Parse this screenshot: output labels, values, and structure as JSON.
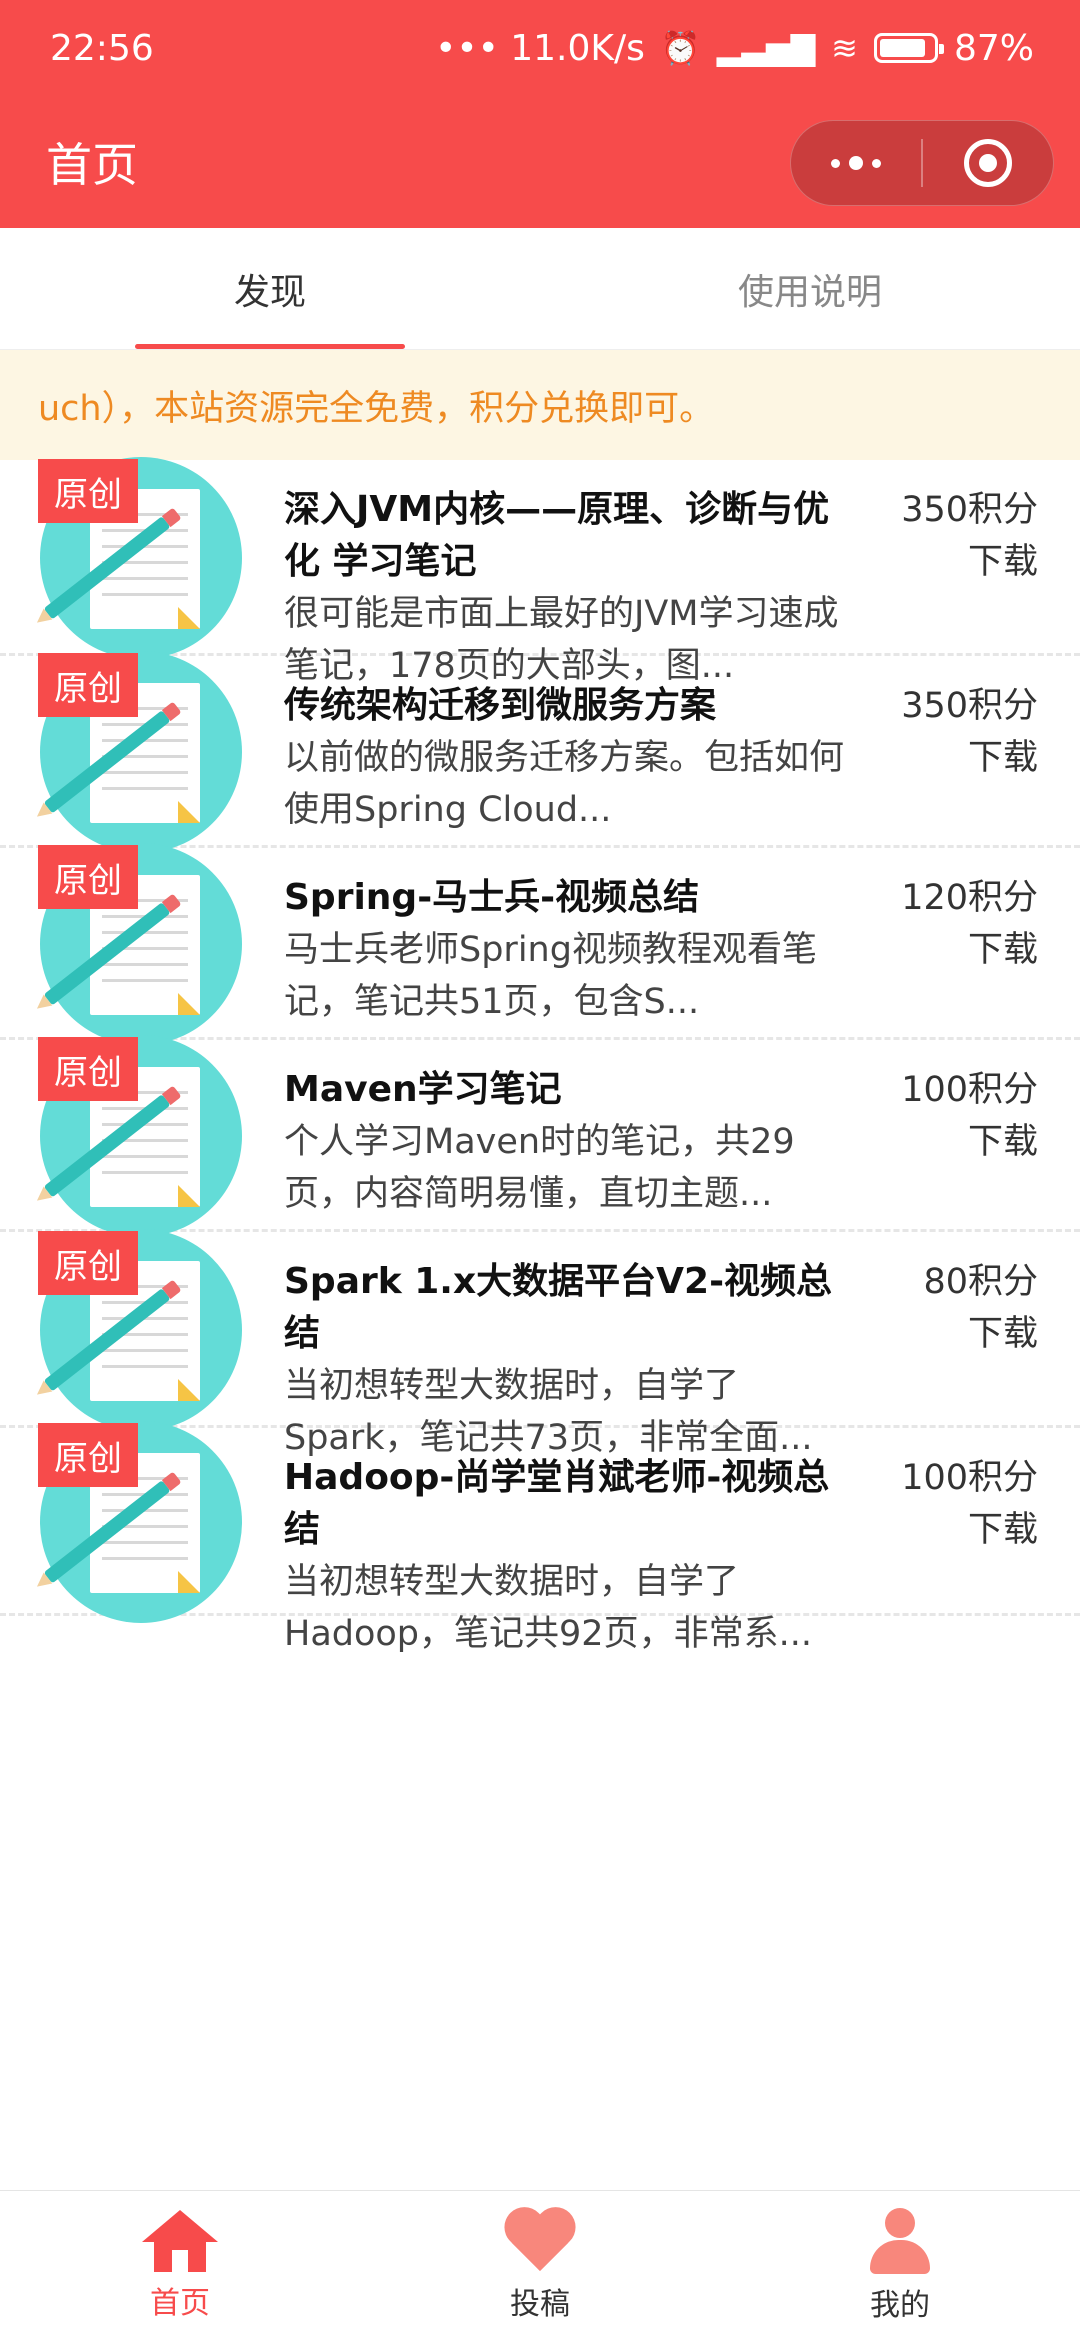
{
  "status": {
    "time": "22:56",
    "speed": "••• 11.0K/s",
    "battery": "87%",
    "battery_level": 0.87
  },
  "navbar": {
    "title": "首页"
  },
  "tabs": [
    {
      "label": "发现",
      "active": true
    },
    {
      "label": "使用说明",
      "active": false
    }
  ],
  "notice": "uch），本站资源完全免费，积分兑换即可。",
  "items": [
    {
      "badge": "原创",
      "title": "深入JVM内核——原理、诊断与优化 学习笔记",
      "desc": "很可能是市面上最好的JVM学习速成笔记，178页的大部头，图...",
      "points": "350积分",
      "action": "下载"
    },
    {
      "badge": "原创",
      "title": "传统架构迁移到微服务方案",
      "desc": "以前做的微服务迁移方案。包括如何使用Spring Cloud...",
      "points": "350积分",
      "action": "下载"
    },
    {
      "badge": "原创",
      "title": "Spring-马士兵-视频总结",
      "desc": "马士兵老师Spring视频教程观看笔记，笔记共51页，包含S...",
      "points": "120积分",
      "action": "下载"
    },
    {
      "badge": "原创",
      "title": "Maven学习笔记",
      "desc": "个人学习Maven时的笔记，共29页，内容简明易懂，直切主题...",
      "points": "100积分",
      "action": "下载"
    },
    {
      "badge": "原创",
      "title": "Spark 1.x大数据平台V2-视频总结",
      "desc": "当初想转型大数据时，自学了Spark，笔记共73页，非常全面...",
      "points": "80积分",
      "action": "下载"
    },
    {
      "badge": "原创",
      "title": "Hadoop-尚学堂肖斌老师-视频总结",
      "desc": "当初想转型大数据时，自学了Hadoop，笔记共92页，非常系...",
      "points": "100积分",
      "action": "下载"
    }
  ],
  "tabbar": [
    {
      "label": "首页",
      "icon": "home-icon",
      "active": true
    },
    {
      "label": "投稿",
      "icon": "heart-icon",
      "active": false
    },
    {
      "label": "我的",
      "icon": "user-icon",
      "active": false
    }
  ],
  "colors": {
    "brand": "#f74b4b",
    "notice_bg": "#fdf6e3",
    "notice_text": "#ee8a22",
    "thumb_circle": "#63dcd7"
  }
}
